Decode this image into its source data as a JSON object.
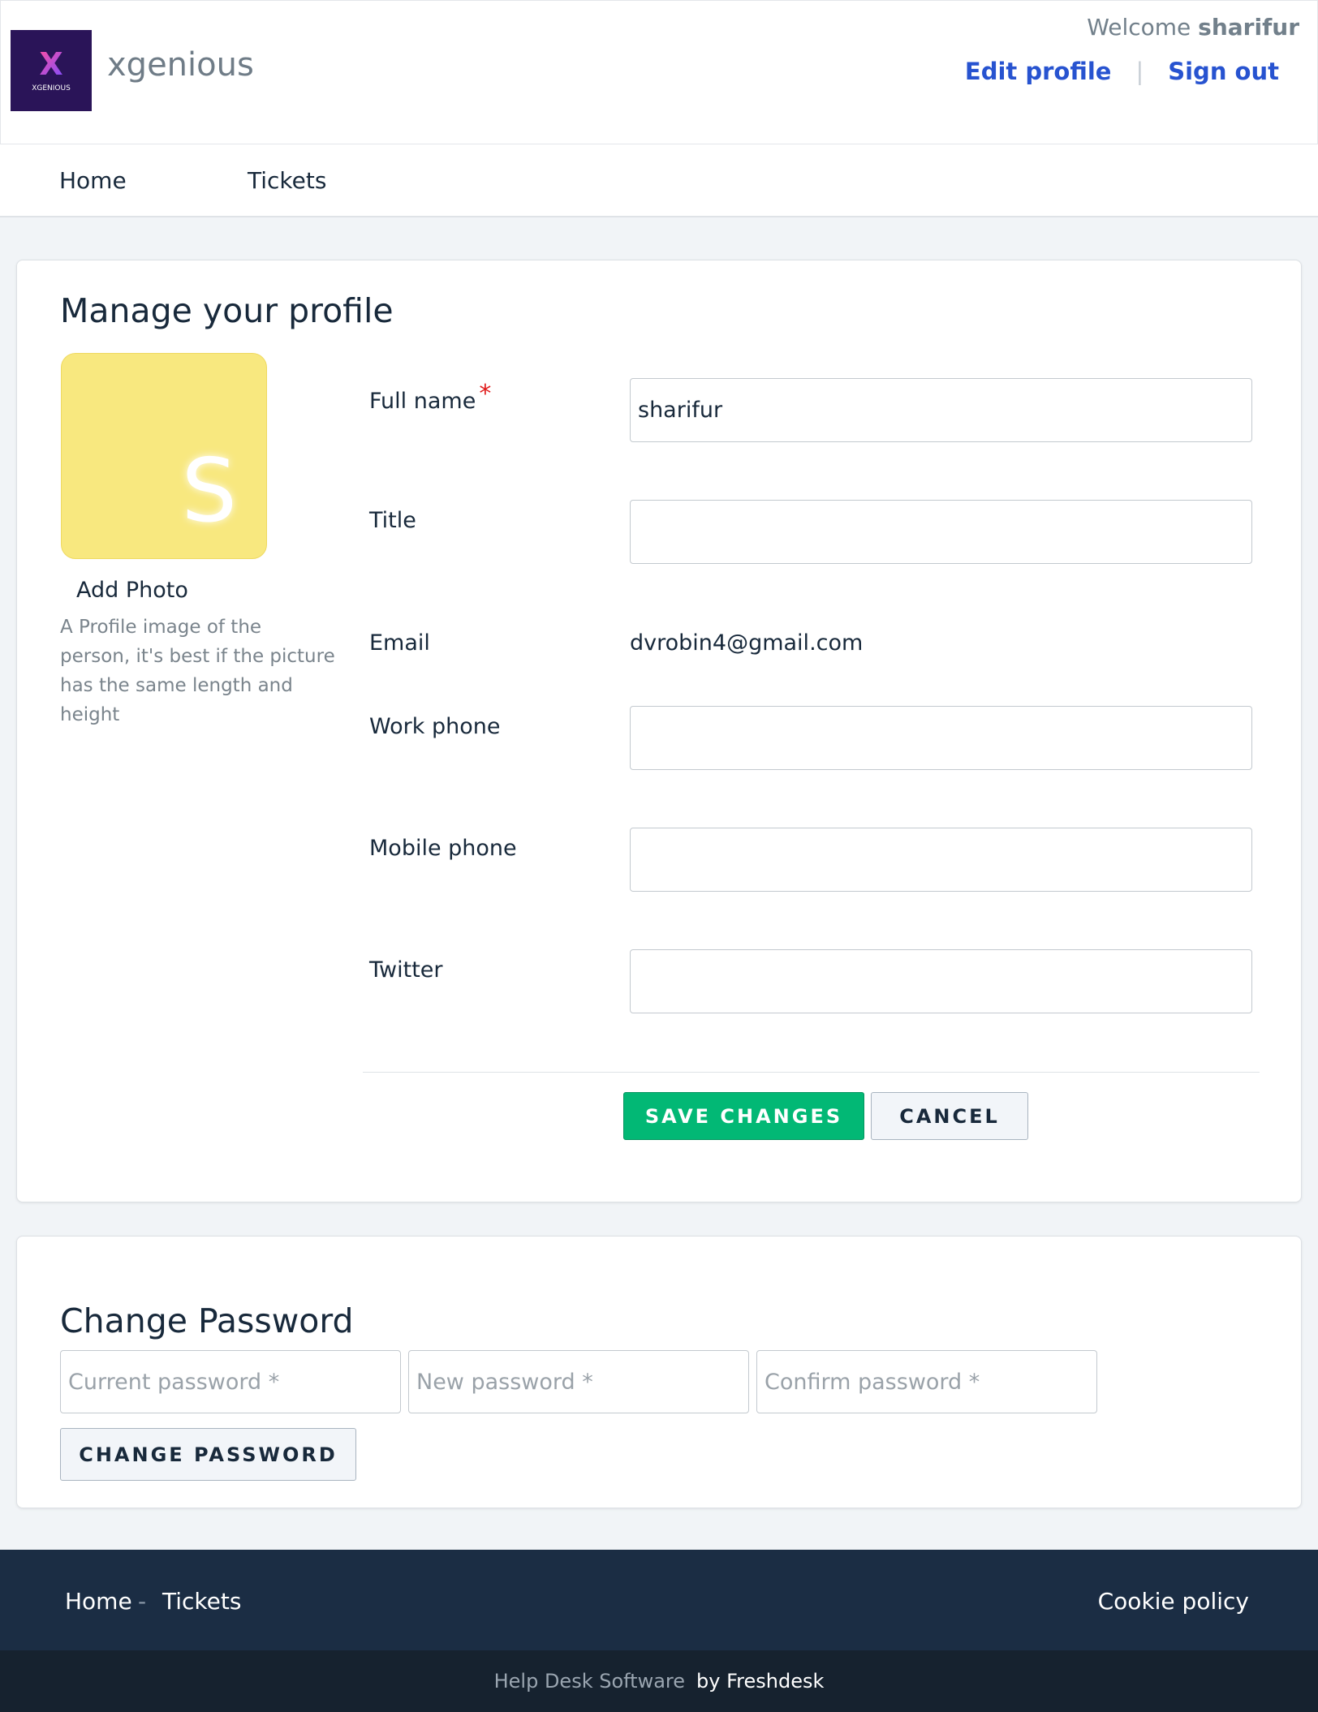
{
  "colors": {
    "primary_button": "#02b875",
    "link": "#2753d0",
    "footer": "#1b2d44",
    "avatar_bg": "#f8e87f",
    "required_star": "#e01b1b"
  },
  "header": {
    "logo_icon": "xgenious-logo-icon",
    "logo_caption": "XGENIOUS",
    "brand_name": "xgenious",
    "welcome_prefix": "Welcome",
    "username": "sharifur",
    "edit_profile": "Edit profile",
    "separator": "|",
    "sign_out": "Sign out"
  },
  "nav": {
    "items": [
      {
        "label": "Home"
      },
      {
        "label": "Tickets"
      }
    ]
  },
  "profile": {
    "title": "Manage your profile",
    "avatar_initial": "S",
    "add_photo": "Add Photo",
    "photo_help": "A Profile image of the person, it's best if the picture has the same length and height",
    "fields": {
      "full_name": {
        "label": "Full name",
        "required_mark": "*",
        "value": "sharifur"
      },
      "title": {
        "label": "Title",
        "value": ""
      },
      "email": {
        "label": "Email",
        "value": "dvrobin4@gmail.com"
      },
      "work_phone": {
        "label": "Work phone",
        "value": ""
      },
      "mobile_phone": {
        "label": "Mobile phone",
        "value": ""
      },
      "twitter": {
        "label": "Twitter",
        "value": ""
      }
    },
    "save_label": "SAVE CHANGES",
    "cancel_label": "CANCEL"
  },
  "password": {
    "title": "Change Password",
    "current_placeholder": "Current password *",
    "new_placeholder": "New password *",
    "confirm_placeholder": "Confirm password *",
    "button_label": "CHANGE PASSWORD"
  },
  "footer": {
    "home": "Home",
    "separator": "-",
    "tickets": "Tickets",
    "cookie_policy": "Cookie policy",
    "powered_prefix": "Help Desk Software",
    "powered_by": "by Freshdesk"
  }
}
